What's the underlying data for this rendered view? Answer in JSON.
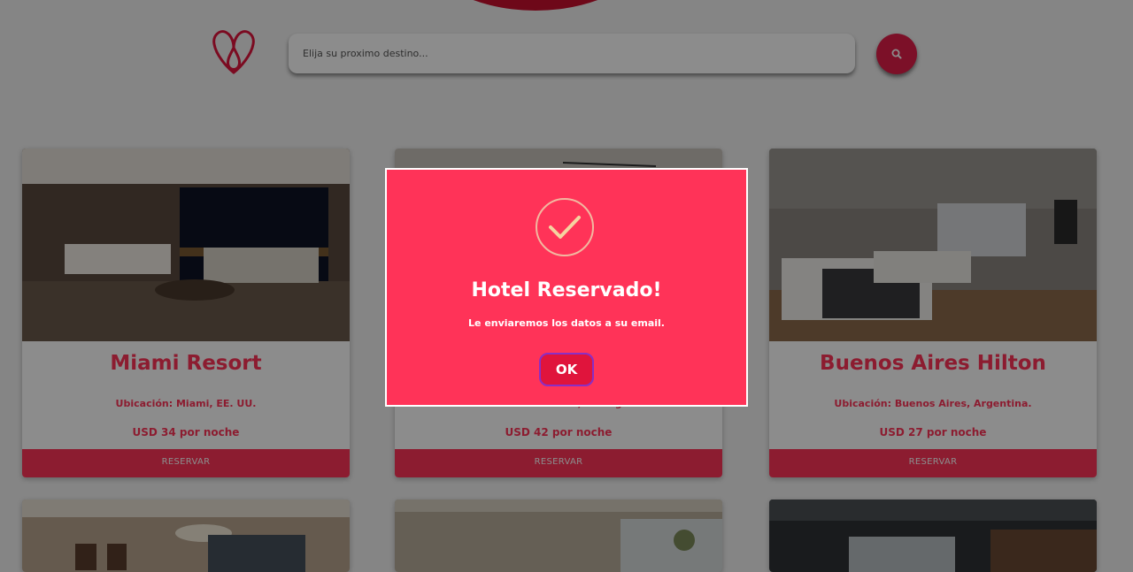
{
  "header": {
    "logo": "heart-drop-logo-icon",
    "search_placeholder": "Elija su proximo destino...",
    "search_icon": "search-icon"
  },
  "hotels": [
    {
      "name": "Miami Resort",
      "location": "Ubicación: Miami, EE. UU.",
      "price": "USD 34 por noche",
      "button": "RESERVAR"
    },
    {
      "name": "",
      "location": "Ubicación: Lisboa, Portugal.",
      "price": "USD 42 por noche",
      "button": "RESERVAR"
    },
    {
      "name": "Buenos Aires Hilton",
      "location": "Ubicación: Buenos Aires, Argentina.",
      "price": "USD 27 por noche",
      "button": "RESERVAR"
    },
    {
      "name": "",
      "location": "",
      "price": "",
      "button": ""
    },
    {
      "name": "",
      "location": "",
      "price": "",
      "button": ""
    },
    {
      "name": "",
      "location": "",
      "price": "",
      "button": ""
    }
  ],
  "modal": {
    "icon": "checkmark-icon",
    "title": "Hotel Reservado!",
    "message": "Le enviaremos los datos a su email.",
    "ok_label": "OK"
  },
  "colors": {
    "brand": "#ff3358",
    "button_dark": "#e0143c",
    "overlay": "rgba(0,0,0,0.45)"
  }
}
